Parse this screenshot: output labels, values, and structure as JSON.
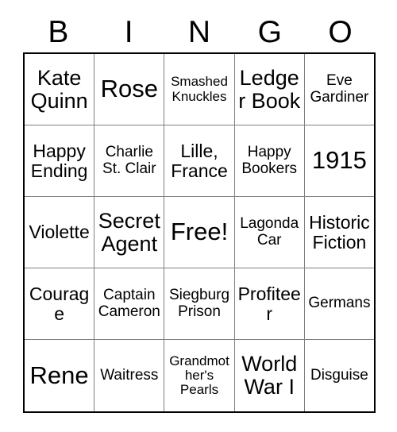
{
  "card": {
    "header": {
      "letters": [
        "B",
        "I",
        "N",
        "G",
        "O"
      ]
    },
    "rows": [
      [
        {
          "text": "Kate Quinn",
          "size": "lg"
        },
        {
          "text": "Rose",
          "size": "xl"
        },
        {
          "text": "Smashed Knuckles",
          "size": "xs"
        },
        {
          "text": "Ledger Book",
          "size": "lg"
        },
        {
          "text": "Eve Gardiner",
          "size": "sm"
        }
      ],
      [
        {
          "text": "Happy Ending",
          "size": "md"
        },
        {
          "text": "Charlie St. Clair",
          "size": "sm"
        },
        {
          "text": "Lille, France",
          "size": "md"
        },
        {
          "text": "Happy Bookers",
          "size": "sm"
        },
        {
          "text": "1915",
          "size": "xl"
        }
      ],
      [
        {
          "text": "Violette",
          "size": "md"
        },
        {
          "text": "Secret Agent",
          "size": "lg"
        },
        {
          "text": "Free!",
          "size": "xl"
        },
        {
          "text": "Lagonda Car",
          "size": "sm"
        },
        {
          "text": "Historic Fiction",
          "size": "md"
        }
      ],
      [
        {
          "text": "Courage",
          "size": "md"
        },
        {
          "text": "Captain Cameron",
          "size": "sm"
        },
        {
          "text": "Siegburg Prison",
          "size": "sm"
        },
        {
          "text": "Profiteer",
          "size": "md"
        },
        {
          "text": "Germans",
          "size": "sm"
        }
      ],
      [
        {
          "text": "Rene",
          "size": "xl"
        },
        {
          "text": "Waitress",
          "size": "sm"
        },
        {
          "text": "Grandmother's Pearls",
          "size": "xs"
        },
        {
          "text": "World War I",
          "size": "lg"
        },
        {
          "text": "Disguise",
          "size": "sm"
        }
      ]
    ]
  }
}
